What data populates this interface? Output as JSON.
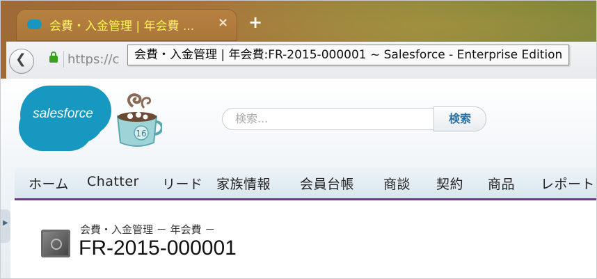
{
  "browser": {
    "tab_title": "会費・入金管理 | 年会費 ...",
    "tab_close_symbol": "×",
    "new_tab_symbol": "+",
    "back_symbol": "❮",
    "url_partial": "https://c",
    "tooltip": "会費・入金管理 | 年会費:FR-2015-000001 ~ Salesforce - Enterprise Edition"
  },
  "header": {
    "logo_text": "salesforce",
    "mascot_badge": "16",
    "search_placeholder": "検索...",
    "search_button": "検索"
  },
  "nav": {
    "tabs": [
      "ホーム",
      "Chatter",
      "リード",
      "家族情報",
      "会員台帳",
      "商談",
      "契約",
      "商品",
      "レポート"
    ]
  },
  "record": {
    "breadcrumb": "会費・入金管理 － 年会費 －",
    "title": "FR-2015-000001"
  },
  "colors": {
    "tab_text": "#fff35a",
    "brand": "#1798c1",
    "nav_underline": "#7e2c9c"
  },
  "icons": {
    "favicon": "salesforce-cloud-icon",
    "lock": "lock-icon",
    "record": "safe-icon"
  }
}
